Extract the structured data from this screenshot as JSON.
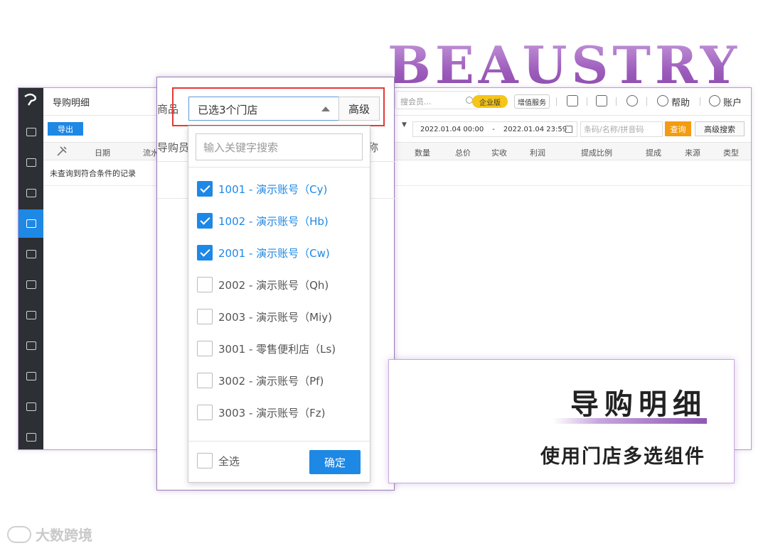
{
  "brand": {
    "title": "BEAUSTRY"
  },
  "app": {
    "page_title": "导购明细",
    "export_label": "导出",
    "empty_text": "未查询到符合条件的记录",
    "columns": [
      "日期",
      "流水",
      "数量",
      "总价",
      "实收",
      "利润",
      "提成比例",
      "提成",
      "来源",
      "类型"
    ],
    "top": {
      "search_placeholder": "搜会员...",
      "enterprise_badge": "企业版",
      "value_added": "增值服务",
      "help": "帮助",
      "account": "账户"
    },
    "filters": {
      "date_start": "2022.01.04 00:00",
      "date_sep": "-",
      "date_end": "2022.01.04 23:59",
      "code_placeholder": "条码/名称/拼音码",
      "query": "查询",
      "advanced_search": "高级搜索"
    }
  },
  "mid_panel": {
    "goods_label": "商品",
    "guide_label": "导购员",
    "name_suffix": "称"
  },
  "store_picker": {
    "selected_text": "已选3个门店",
    "advanced": "高级",
    "search_placeholder": "输入关键字搜索",
    "stores": [
      {
        "label": "1001 - 演示账号（Cy)",
        "checked": true
      },
      {
        "label": "1002 - 演示账号（Hb)",
        "checked": true
      },
      {
        "label": "2001 - 演示账号（Cw)",
        "checked": true
      },
      {
        "label": "2002 - 演示账号（Qh)",
        "checked": false
      },
      {
        "label": "2003 - 演示账号（Miy)",
        "checked": false
      },
      {
        "label": "3001 - 零售便利店（Ls)",
        "checked": false
      },
      {
        "label": "3002 - 演示账号（Pf)",
        "checked": false
      },
      {
        "label": "3003 - 演示账号（Fz)",
        "checked": false
      }
    ],
    "select_all": "全选",
    "confirm": "确定"
  },
  "caption": {
    "title": "导购明细",
    "subtitle": "使用门店多选组件"
  },
  "watermark": {
    "text": "大数跨境"
  },
  "colors": {
    "accent": "#1e88e5",
    "highlight": "#e53935",
    "brand_purple": "#9d5cbc",
    "query": "#f39c12"
  }
}
